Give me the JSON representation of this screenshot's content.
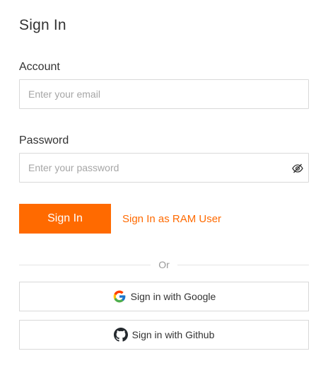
{
  "page": {
    "title": "Sign In"
  },
  "account": {
    "label": "Account",
    "placeholder": "Enter your email"
  },
  "password": {
    "label": "Password",
    "placeholder": "Enter your password",
    "toggle_icon": "eye-slash-icon"
  },
  "actions": {
    "signin_label": "Sign In",
    "ram_link_label": "Sign In as RAM User"
  },
  "divider": {
    "label": "Or"
  },
  "oauth": {
    "google_label": "Sign in with Google",
    "google_icon": "google-icon",
    "github_label": "Sign in with Github",
    "github_icon": "github-icon"
  },
  "colors": {
    "accent": "#ff6a00",
    "border": "#d9d9d9",
    "text": "#333333",
    "placeholder": "#a6a6a6"
  }
}
